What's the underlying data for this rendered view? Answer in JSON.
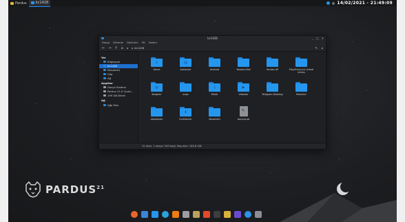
{
  "topbar": {
    "start_label": "Pardus",
    "task_label": "kc1428",
    "clock": "14/02/2021 - 21:49:09"
  },
  "window": {
    "title": "kc1428",
    "controls": [
      "_",
      "▢",
      "×"
    ],
    "menu": [
      "Dosya",
      "Düzenle",
      "Görünüm",
      "Git",
      "Yardım"
    ],
    "path": "kc1428",
    "status": "15 dizin, 1 dosya: 549 bayt, Boş alan: 183,6 GiB"
  },
  "sidebar": {
    "sections": [
      {
        "header": "Yer",
        "items": [
          {
            "label": "Bilgisayar",
            "icon": "computer-icon",
            "selected": false
          },
          {
            "label": "kc1428",
            "icon": "home-folder-icon",
            "selected": true
          },
          {
            "label": "Masaüstü",
            "icon": "desktop-folder-icon",
            "selected": false
          },
          {
            "label": "Çöp",
            "icon": "trash-icon",
            "selected": false
          },
          {
            "label": "Ağ",
            "icon": "network-icon",
            "selected": false
          }
        ]
      },
      {
        "header": "Aygıtlar",
        "items": [
          {
            "label": "Dosya Sistemi",
            "icon": "drive-icon",
            "selected": false
          },
          {
            "label": "Pardus 21.0 Cordi...",
            "icon": "drive-icon",
            "selected": false
          },
          {
            "label": "199 GB Birimi",
            "icon": "drive-icon",
            "selected": false
          }
        ]
      },
      {
        "header": "Ağ",
        "items": [
          {
            "label": "Ağa Talo",
            "icon": "network-icon",
            "selected": false
          }
        ]
      }
    ]
  },
  "files": [
    {
      "name": "Genel",
      "type": "folder",
      "emblem": "♫"
    },
    {
      "name": "Şablonlar",
      "type": "folder",
      "emblem": "▤"
    },
    {
      "name": "Android",
      "type": "folder",
      "emblem": ""
    },
    {
      "name": "Yandex.Disk",
      "type": "folder",
      "emblem": ""
    },
    {
      "name": "Yandex AP",
      "type": "folder",
      "emblem": ""
    },
    {
      "name": "PlayOnLinux's virtual drives",
      "type": "folder",
      "emblem": ""
    },
    {
      "name": "Belgeler",
      "type": "folder",
      "emblem": "▤"
    },
    {
      "name": "snap",
      "type": "folder",
      "emblem": ""
    },
    {
      "name": "Müzik",
      "type": "folder",
      "emblem": "♫"
    },
    {
      "name": "Videolar",
      "type": "folder",
      "emblem": "▶"
    },
    {
      "name": "Telegram Desktop",
      "type": "folder",
      "emblem": ""
    },
    {
      "name": "Resimler",
      "type": "folder",
      "emblem": ""
    },
    {
      "name": "darkeleşer",
      "type": "folder",
      "emblem": ""
    },
    {
      "name": "İndirilenler",
      "type": "folder",
      "emblem": "⬇"
    },
    {
      "name": "Masaüstü",
      "type": "folder",
      "emblem": ""
    },
    {
      "name": "backup.ab",
      "type": "file",
      "emblem": "✎"
    }
  ],
  "branding": {
    "logo_text": "PARDUS",
    "logo_version": "21"
  },
  "dock": [
    {
      "icon": "firefox-icon",
      "color": "#e8662a"
    },
    {
      "icon": "files-icon",
      "color": "#3b84d8"
    },
    {
      "icon": "folder-icon",
      "color": "#2596ee"
    },
    {
      "icon": "telegram-icon",
      "color": "#2aa3dc"
    },
    {
      "icon": "vlc-icon",
      "color": "#ee7c10"
    },
    {
      "icon": "settings-icon",
      "color": "#9b9ea3"
    },
    {
      "icon": "gimp-icon",
      "color": "#b8a15a"
    },
    {
      "icon": "software-center-icon",
      "color": "#e24a2a"
    },
    {
      "icon": "terminal-icon",
      "color": "#3b3d40"
    },
    {
      "icon": "text-editor-icon",
      "color": "#d8b23b"
    },
    {
      "icon": "media-player-icon",
      "color": "#6a4bd1"
    },
    {
      "icon": "photos-icon",
      "color": "#2b93e6"
    },
    {
      "icon": "screen-icon",
      "color": "#8a8d93"
    }
  ]
}
